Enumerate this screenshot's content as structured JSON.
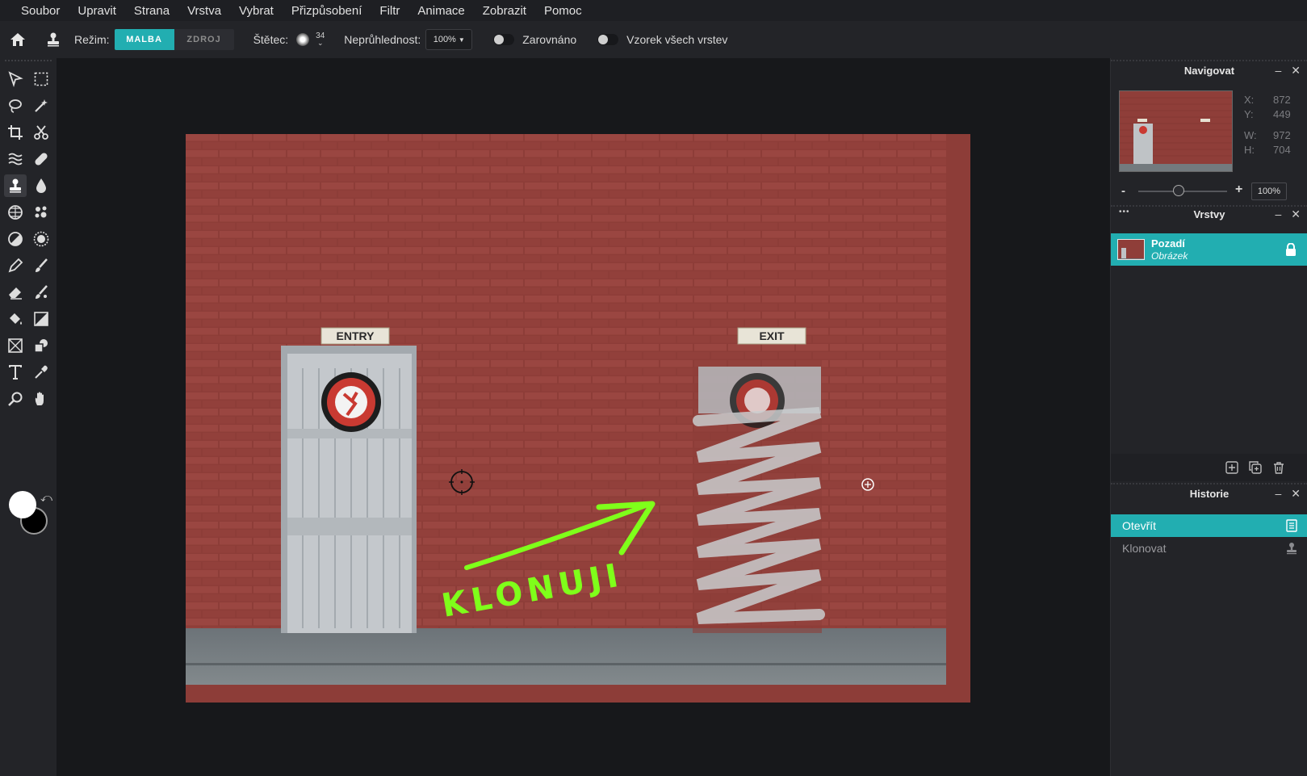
{
  "menu": [
    "Soubor",
    "Upravit",
    "Strana",
    "Vrstva",
    "Vybrat",
    "Přizpůsobení",
    "Filtr",
    "Animace",
    "Zobrazit",
    "Pomoc"
  ],
  "options": {
    "mode_label": "Režim:",
    "mode_paint": "MALBA",
    "mode_source": "ZDROJ",
    "brush_label": "Štětec:",
    "brush_size": "34",
    "opacity_label": "Neprůhlednost:",
    "opacity_value": "100%",
    "aligned_label": "Zarovnáno",
    "sample_all_label": "Vzorek všech vrstev"
  },
  "canvas": {
    "sign_entry": "ENTRY",
    "sign_exit": "EXIT",
    "annotation": "KLONUJI",
    "accent_arrow": "#7fff1a",
    "brick_color": "#8d3d38"
  },
  "navigator": {
    "title": "Navigovat",
    "x_label": "X:",
    "x": "872",
    "y_label": "Y:",
    "y": "449",
    "w_label": "W:",
    "w": "972",
    "h_label": "H:",
    "h": "704",
    "zoom_minus": "-",
    "zoom_plus": "+",
    "zoom_value": "100%",
    "zoom_level_fraction": 0.45
  },
  "layers": {
    "title": "Vrstvy",
    "items": [
      {
        "name": "Pozadí",
        "type": "Obrázek",
        "locked": true
      }
    ]
  },
  "history": {
    "title": "Historie",
    "items": [
      {
        "label": "Otevřít",
        "icon": "document-icon",
        "active": true
      },
      {
        "label": "Klonovat",
        "icon": "stamp-icon",
        "active": false
      }
    ]
  },
  "colors": {
    "accent": "#22aeb1",
    "foreground": "#ffffff",
    "background": "#000000"
  },
  "panel_controls": {
    "minimize": "–",
    "close": "✕",
    "more": "•••"
  }
}
